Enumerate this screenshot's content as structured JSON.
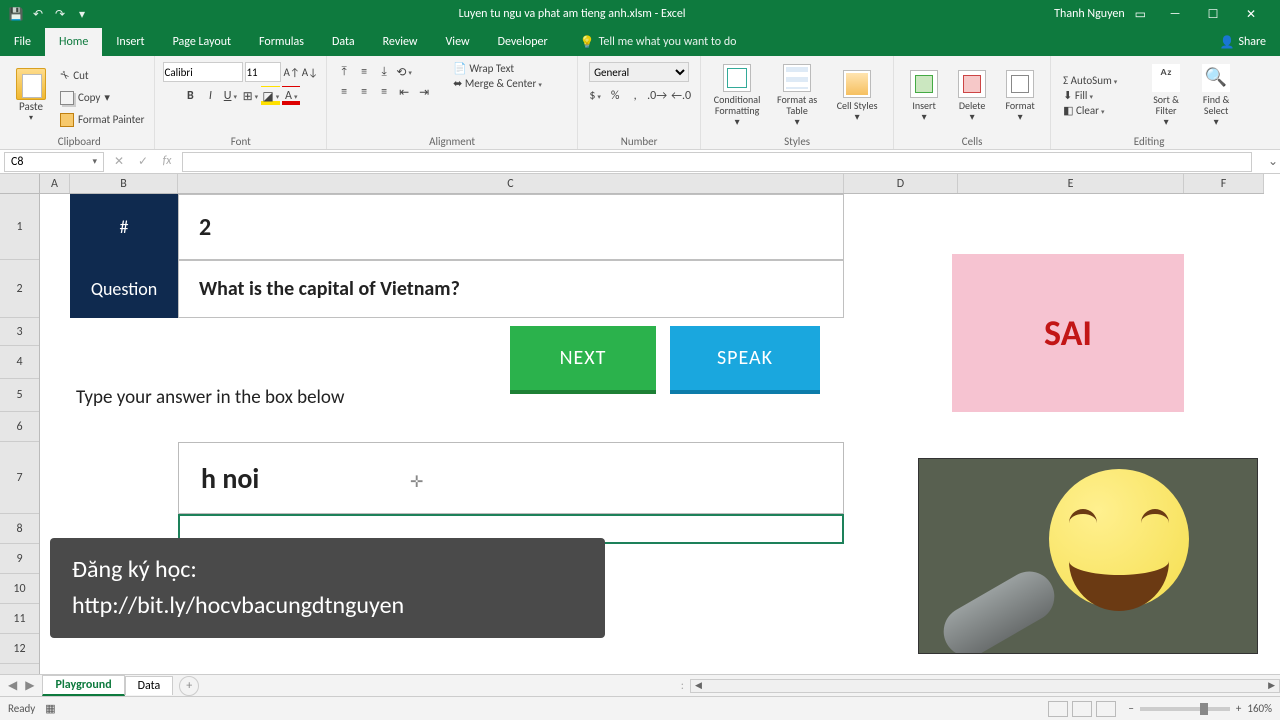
{
  "titlebar": {
    "filename": "Luyen tu ngu va phat am tieng anh.xlsm  -  Excel",
    "user": "Thanh Nguyen"
  },
  "tabs": {
    "file": "File",
    "home": "Home",
    "insert": "Insert",
    "page_layout": "Page Layout",
    "formulas": "Formulas",
    "data": "Data",
    "review": "Review",
    "view": "View",
    "developer": "Developer",
    "tell_me": "Tell me what you want to do",
    "share": "Share"
  },
  "ribbon": {
    "clipboard": {
      "label": "Clipboard",
      "paste": "Paste",
      "cut": "Cut",
      "copy": "Copy",
      "painter": "Format Painter"
    },
    "font": {
      "label": "Font",
      "name": "Calibri",
      "size": "11"
    },
    "alignment": {
      "label": "Alignment",
      "wrap": "Wrap Text",
      "merge": "Merge & Center"
    },
    "number": {
      "label": "Number",
      "format": "General"
    },
    "styles": {
      "label": "Styles",
      "cond": "Conditional Formatting",
      "table": "Format as Table",
      "cell": "Cell Styles"
    },
    "cells": {
      "label": "Cells",
      "insert": "Insert",
      "delete": "Delete",
      "format": "Format"
    },
    "editing": {
      "label": "Editing",
      "autosum": "AutoSum",
      "fill": "Fill",
      "clear": "Clear",
      "sort": "Sort & Filter",
      "find": "Find & Select"
    }
  },
  "formula_bar": {
    "name_box": "C8"
  },
  "columns": {
    "A": "A",
    "B": "B",
    "C": "C",
    "D": "D",
    "E": "E",
    "F": "F"
  },
  "rows": [
    "1",
    "2",
    "3",
    "4",
    "5",
    "6",
    "7",
    "8",
    "9",
    "10",
    "11",
    "12"
  ],
  "worksheet": {
    "num_label": "#",
    "num_value": "2",
    "question_label": "Question",
    "question_value": "What is the capital of Vietnam?",
    "next_btn": "NEXT",
    "speak_btn": "SPEAK",
    "instruction": "Type your answer in the box below",
    "answer_value": "h noi",
    "result": "SAI"
  },
  "overlay": {
    "line1": "Đăng ký học:",
    "line2": "http://bit.ly/hocvbacungdtnguyen"
  },
  "sheet_tabs": {
    "playground": "Playground",
    "data": "Data"
  },
  "status": {
    "ready": "Ready",
    "zoom": "160%"
  }
}
